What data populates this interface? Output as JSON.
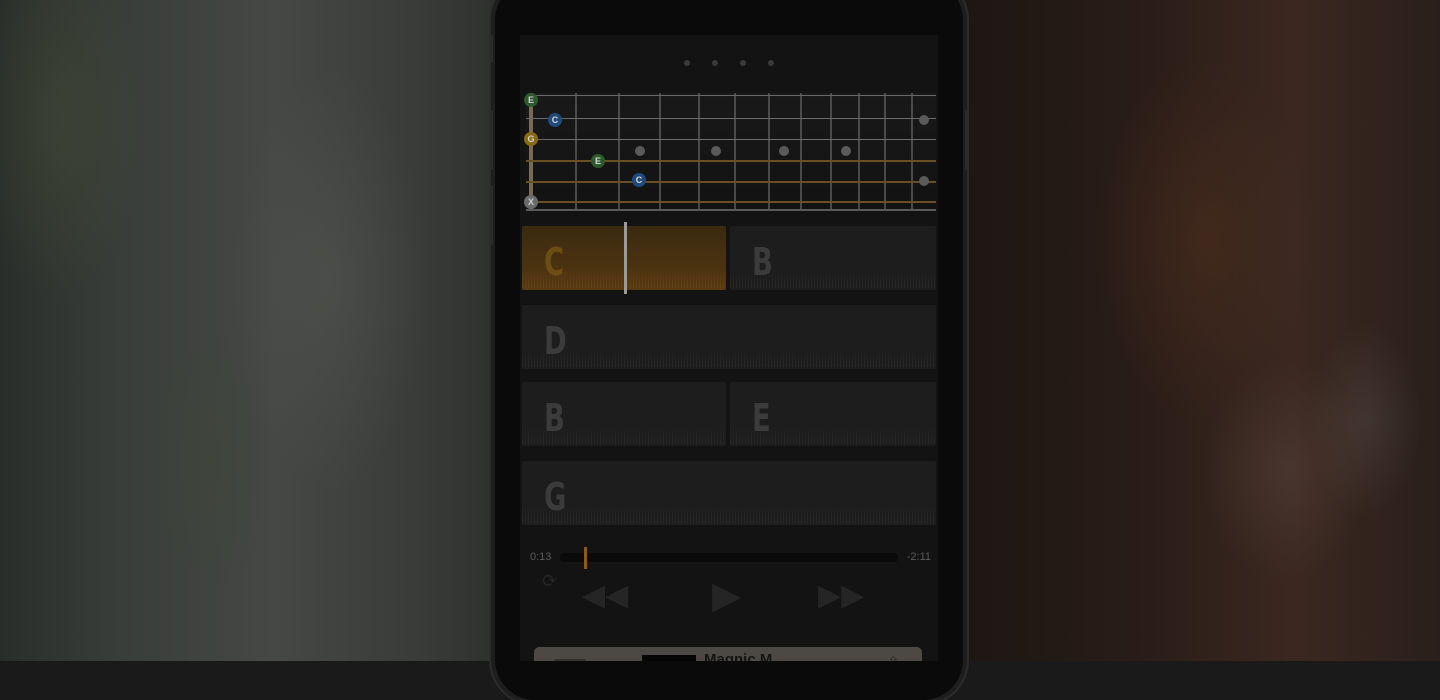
{
  "fretboard": {
    "open_strings": [
      {
        "label": "E",
        "color": "#2c5a2c"
      },
      {
        "label": "G",
        "color": "#8a6a10"
      },
      {
        "label": "X",
        "color": "#6a6a6a"
      }
    ],
    "fretted_notes": [
      {
        "label": "C",
        "color": "#1f4a7a"
      },
      {
        "label": "E",
        "color": "#2c5a2c"
      },
      {
        "label": "C",
        "color": "#1f4a7a"
      }
    ]
  },
  "chords": {
    "row1": {
      "left": "C",
      "right": "B"
    },
    "row2": {
      "full": "D"
    },
    "row3": {
      "left": "B",
      "right": "E"
    },
    "row4": {
      "full": "G"
    }
  },
  "playback": {
    "elapsed": "0:13",
    "remaining": "-2:11",
    "progress": 0.07
  },
  "mini_player": {
    "title": "Magnic M..."
  },
  "colors": {
    "accent": "#8a5a18",
    "active_chord": "#6c4e14"
  },
  "icons": [
    "rewind-icon",
    "play-icon",
    "fast-forward-icon",
    "loop-icon",
    "share-icon"
  ]
}
